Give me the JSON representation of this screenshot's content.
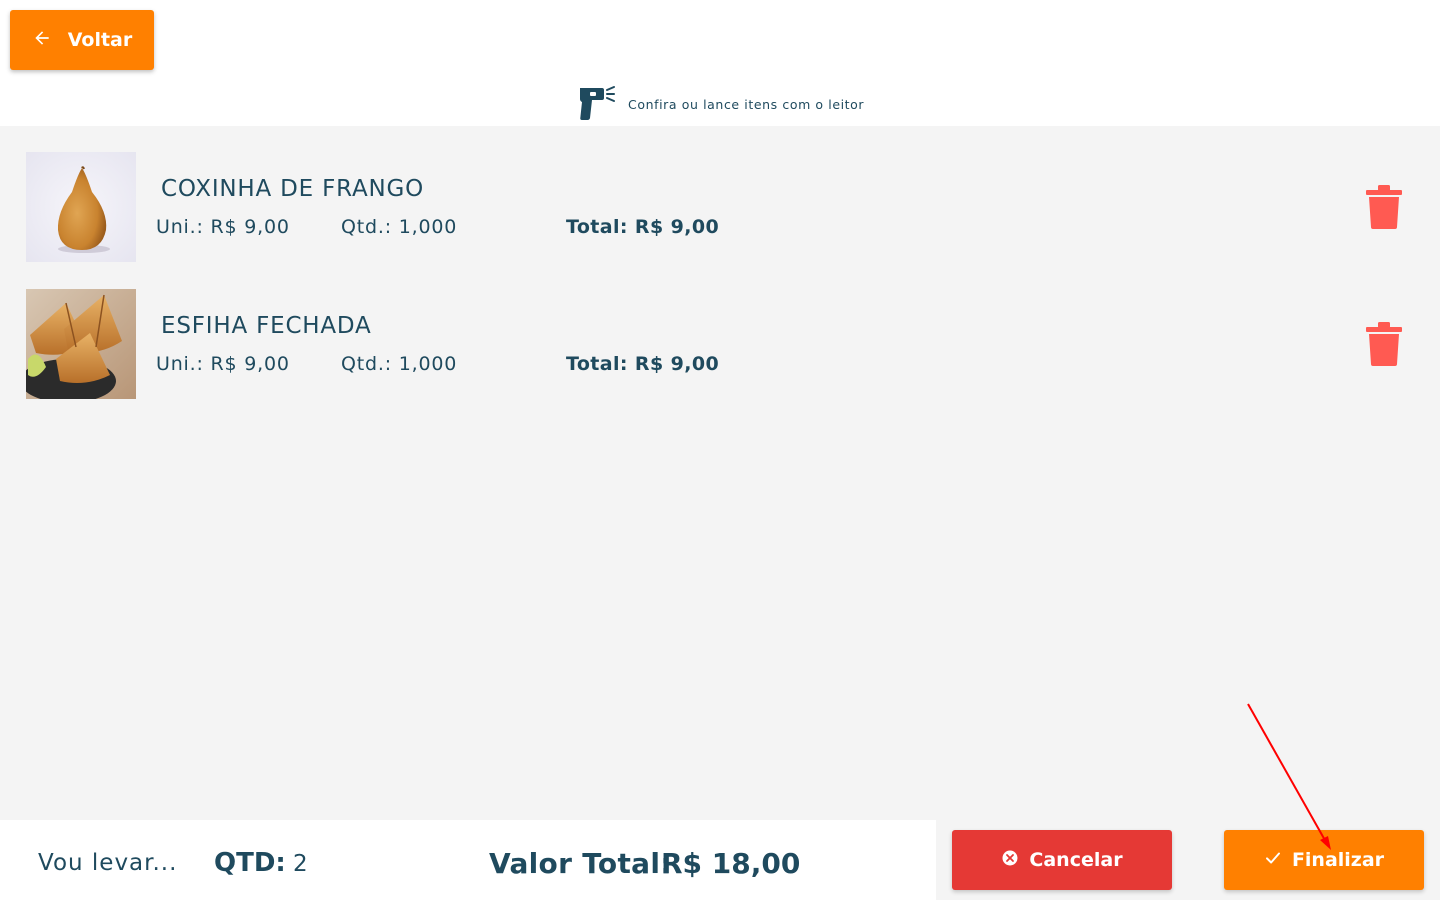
{
  "header": {
    "back_label": "Voltar",
    "reader_hint": "Confira ou lance itens com o leitor"
  },
  "items": [
    {
      "name": "COXINHA DE FRANGO",
      "unit": "Uni.: R$ 9,00",
      "qty": "Qtd.:  1,000",
      "total": "Total: R$ 9,00"
    },
    {
      "name": "ESFIHA FECHADA",
      "unit": "Uni.: R$ 9,00",
      "qty": "Qtd.:  1,000",
      "total": "Total: R$ 9,00"
    }
  ],
  "footer": {
    "vou_levar": "Vou levar...",
    "qtd_label": "QTD:",
    "qtd_value": "2",
    "total_label": "Valor Total:",
    "total_value": "R$ 18,00"
  },
  "actions": {
    "cancel_label": "Cancelar",
    "finish_label": "Finalizar"
  },
  "icons": {
    "back": "arrow-left-icon",
    "reader": "barcode-scanner-icon",
    "trash": "trash-icon",
    "cancel": "close-circle-icon",
    "finish": "check-icon"
  },
  "colors": {
    "primary": "#ff8000",
    "danger": "#e53935",
    "trash": "#ff5a52",
    "text": "#1f4a5e",
    "background": "#f4f4f4"
  }
}
